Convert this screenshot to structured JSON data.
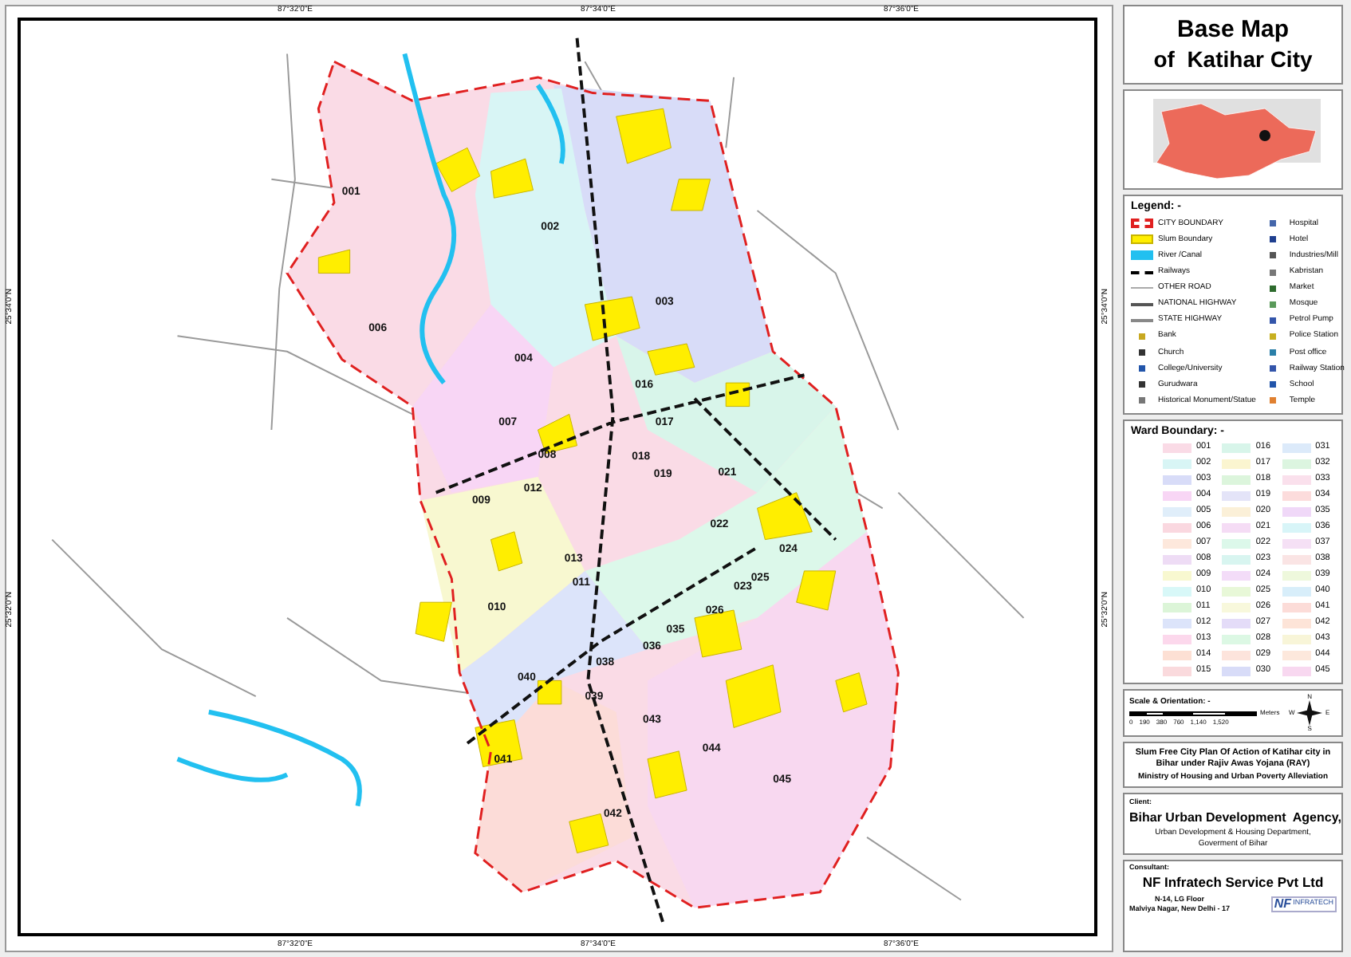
{
  "title": {
    "line_1": "Base Map",
    "line_2": "of  Katihar City"
  },
  "map": {
    "top_ticks": [
      "87°32'0\"E",
      "87°34'0\"E",
      "87°36'0\"E"
    ],
    "bottom_ticks": [
      "87°32'0\"E",
      "87°34'0\"E",
      "87°36'0\"E"
    ],
    "left_ticks": [
      "25°34'0\"N",
      "25°32'0\"N"
    ],
    "right_ticks": [
      "25°34'0\"N",
      "25°32'0\"N"
    ],
    "ward_labels": [
      "001",
      "002",
      "003",
      "006",
      "004",
      "016",
      "017",
      "007",
      "008",
      "018",
      "019",
      "021",
      "022",
      "009",
      "012",
      "013",
      "023",
      "024",
      "010",
      "011",
      "026",
      "025",
      "035",
      "036",
      "038",
      "040",
      "039",
      "041",
      "042",
      "043",
      "044",
      "045"
    ]
  },
  "legend": {
    "heading": "Legend: -",
    "left": [
      {
        "label": "CITY BOUNDARY",
        "kind": "boundary"
      },
      {
        "label": "Slum Boundary",
        "kind": "slum"
      },
      {
        "label": "River /Canal",
        "kind": "river"
      },
      {
        "label": "Railways",
        "kind": "railway"
      },
      {
        "label": "OTHER ROAD",
        "kind": "other_road"
      },
      {
        "label": "NATIONAL HIGHWAY",
        "kind": "national_highway"
      },
      {
        "label": "STATE HIGHWAY",
        "kind": "state_highway"
      },
      {
        "label": "Bank",
        "kind": "symbol",
        "color": "#c8a820"
      },
      {
        "label": "Church",
        "kind": "symbol",
        "color": "#333333"
      },
      {
        "label": "College/University",
        "kind": "symbol",
        "color": "#2255aa"
      },
      {
        "label": "Gurudwara",
        "kind": "symbol",
        "color": "#333333"
      },
      {
        "label": "Historical Monument/Statue",
        "kind": "symbol",
        "color": "#777777"
      }
    ],
    "right": [
      {
        "label": "Hospital",
        "kind": "symbol",
        "color": "#4466aa"
      },
      {
        "label": "Hotel",
        "kind": "symbol",
        "color": "#1f3f8f"
      },
      {
        "label": "Industries/Mill",
        "kind": "symbol",
        "color": "#555555"
      },
      {
        "label": "Kabristan",
        "kind": "symbol",
        "color": "#777777"
      },
      {
        "label": "Market",
        "kind": "symbol",
        "color": "#2e6b2e"
      },
      {
        "label": "Mosque",
        "kind": "symbol",
        "color": "#5a9a5a"
      },
      {
        "label": "Petrol Pump",
        "kind": "symbol",
        "color": "#3355aa"
      },
      {
        "label": "Police Station",
        "kind": "symbol",
        "color": "#c8b020"
      },
      {
        "label": "Post office",
        "kind": "symbol",
        "color": "#2a7fa8"
      },
      {
        "label": "Railway Station",
        "kind": "symbol",
        "color": "#3355aa"
      },
      {
        "label": "School",
        "kind": "symbol",
        "color": "#2255aa"
      },
      {
        "label": "Temple",
        "kind": "symbol",
        "color": "#e08030"
      }
    ]
  },
  "ward_boundary": {
    "heading": "Ward Boundary: -",
    "wards": [
      {
        "label": "001",
        "color": "#fadbe6"
      },
      {
        "label": "002",
        "color": "#d8f5f5"
      },
      {
        "label": "003",
        "color": "#d8dcf8"
      },
      {
        "label": "004",
        "color": "#f8d6f5"
      },
      {
        "label": "005",
        "color": "#e0eefa"
      },
      {
        "label": "006",
        "color": "#fad8e0"
      },
      {
        "label": "007",
        "color": "#fde8dc"
      },
      {
        "label": "008",
        "color": "#eedcf5"
      },
      {
        "label": "009",
        "color": "#f8f8d0"
      },
      {
        "label": "010",
        "color": "#d8f8f8"
      },
      {
        "label": "011",
        "color": "#dcf5d8"
      },
      {
        "label": "012",
        "color": "#dce4fa"
      },
      {
        "label": "013",
        "color": "#fcd8ec"
      },
      {
        "label": "014",
        "color": "#fde0d4"
      },
      {
        "label": "015",
        "color": "#fadadd"
      },
      {
        "label": "016",
        "color": "#d8f5ea"
      },
      {
        "label": "017",
        "color": "#fbf5d0"
      },
      {
        "label": "018",
        "color": "#dcf5dc"
      },
      {
        "label": "019",
        "color": "#e4e4f8"
      },
      {
        "label": "020",
        "color": "#fbf0d8"
      },
      {
        "label": "021",
        "color": "#f5dcf5"
      },
      {
        "label": "022",
        "color": "#dcf8ea"
      },
      {
        "label": "023",
        "color": "#d8f5f0"
      },
      {
        "label": "024",
        "color": "#f3dcf8"
      },
      {
        "label": "025",
        "color": "#e8f8d8"
      },
      {
        "label": "026",
        "color": "#f8f8dc"
      },
      {
        "label": "027",
        "color": "#e4dcf8"
      },
      {
        "label": "028",
        "color": "#dcf8e4"
      },
      {
        "label": "029",
        "color": "#fde4dc"
      },
      {
        "label": "030",
        "color": "#d8dcf8"
      },
      {
        "label": "031",
        "color": "#dceafa"
      },
      {
        "label": "032",
        "color": "#dcf5e0"
      },
      {
        "label": "033",
        "color": "#fae0ec"
      },
      {
        "label": "034",
        "color": "#fcdcdc"
      },
      {
        "label": "035",
        "color": "#f0d8f8"
      },
      {
        "label": "036",
        "color": "#d8f5f8"
      },
      {
        "label": "037",
        "color": "#f5e0f5"
      },
      {
        "label": "038",
        "color": "#fae4e4"
      },
      {
        "label": "039",
        "color": "#eef8dc"
      },
      {
        "label": "040",
        "color": "#d8eefa"
      },
      {
        "label": "041",
        "color": "#fcdcd8"
      },
      {
        "label": "042",
        "color": "#fde4d8"
      },
      {
        "label": "043",
        "color": "#f8f5d8"
      },
      {
        "label": "044",
        "color": "#fde8dc"
      },
      {
        "label": "045",
        "color": "#f8d8f0"
      }
    ]
  },
  "scale": {
    "heading": "Scale & Orientation: -",
    "ticks": [
      "0",
      "190",
      "380",
      "760",
      "1,140",
      "1,520"
    ],
    "unit": "Meters",
    "compass": {
      "north": "N",
      "east": "E",
      "south": "S",
      "west": "W"
    }
  },
  "plan": {
    "title": "Slum Free City Plan Of Action of Katihar city in Bihar under Rajiv Awas Yojana (RAY)",
    "ministry": "Ministry of Housing and Urban Poverty Alleviation"
  },
  "client": {
    "heading": "Client:",
    "name": "Bihar Urban Development  Agency,",
    "department": "Urban Development & Housing Department,",
    "government": "Goverment of Bihar"
  },
  "consultant": {
    "heading": "Consultant:",
    "name": "NF Infratech Service Pvt Ltd",
    "address": [
      "N-14, LG Floor",
      "Malviya Nagar, New Delhi - 17"
    ],
    "logo": {
      "letters": "NF",
      "word": "INFRATECH"
    }
  }
}
